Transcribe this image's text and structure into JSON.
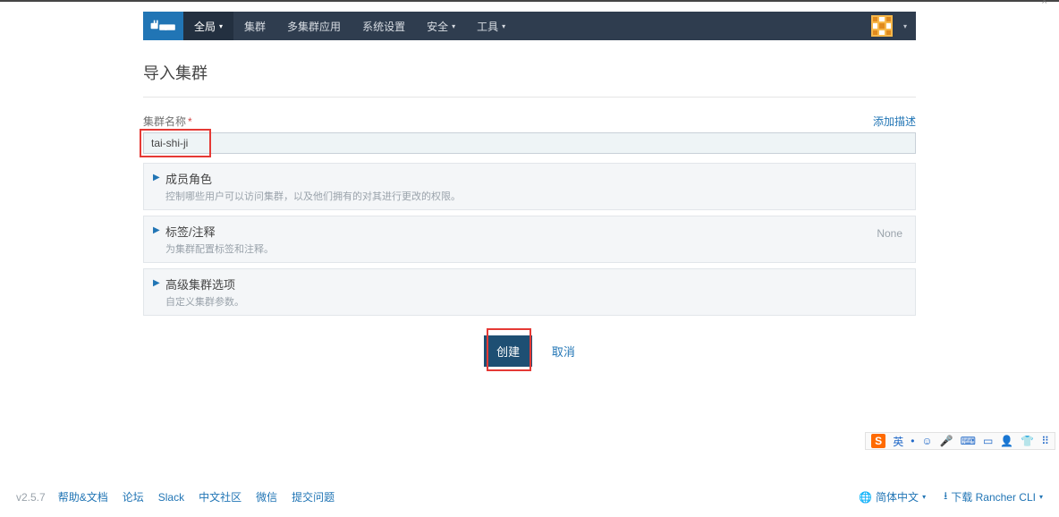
{
  "nav": {
    "items": [
      {
        "label": "全局",
        "caret": true,
        "active": true
      },
      {
        "label": "集群",
        "caret": false
      },
      {
        "label": "多集群应用",
        "caret": false
      },
      {
        "label": "系统设置",
        "caret": false
      },
      {
        "label": "安全",
        "caret": true
      },
      {
        "label": "工具",
        "caret": true
      }
    ]
  },
  "page": {
    "title": "导入集群",
    "name_label": "集群名称",
    "required_mark": "*",
    "add_desc": "添加描述",
    "name_value": "tai-shi-ji"
  },
  "accordions": [
    {
      "title": "成员角色",
      "sub": "控制哪些用户可以访问集群，以及他们拥有的对其进行更改的权限。",
      "right": ""
    },
    {
      "title": "标签/注释",
      "sub": "为集群配置标签和注释。",
      "right": "None"
    },
    {
      "title": "高级集群选项",
      "sub": "自定义集群参数。",
      "right": ""
    }
  ],
  "actions": {
    "create": "创建",
    "cancel": "取消"
  },
  "footer": {
    "version": "v2.5.7",
    "links": [
      "帮助&文档",
      "论坛",
      "Slack",
      "中文社区",
      "微信",
      "提交问题"
    ],
    "lang": "简体中文",
    "download": "下载 Rancher CLI"
  },
  "ime": {
    "logo": "S",
    "items": [
      "英",
      "•",
      "☺",
      "🎤",
      "⌨",
      "▭",
      "👤",
      "👕",
      "⠿"
    ]
  }
}
